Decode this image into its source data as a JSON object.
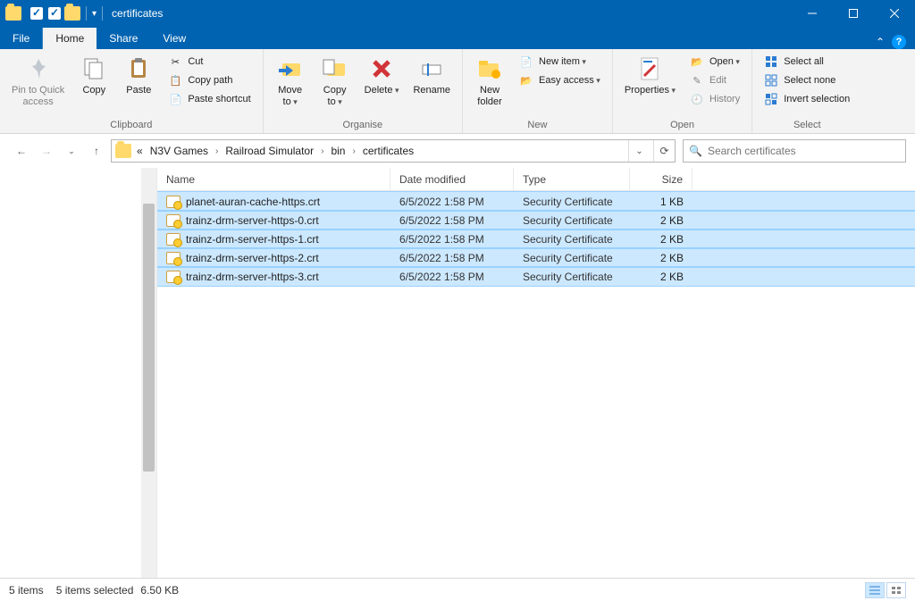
{
  "window": {
    "title": "certificates"
  },
  "tabs": {
    "file": "File",
    "home": "Home",
    "share": "Share",
    "view": "View"
  },
  "ribbon": {
    "clipboard": {
      "name": "Clipboard",
      "pin": "Pin to Quick\naccess",
      "copy": "Copy",
      "paste": "Paste",
      "cut": "Cut",
      "copypath": "Copy path",
      "pasteshortcut": "Paste shortcut"
    },
    "organise": {
      "name": "Organise",
      "move": "Move\nto",
      "copyto": "Copy\nto",
      "delete": "Delete",
      "rename": "Rename"
    },
    "new": {
      "name": "New",
      "newfolder": "New\nfolder",
      "newitem": "New item",
      "easyaccess": "Easy access"
    },
    "open": {
      "name": "Open",
      "properties": "Properties",
      "open": "Open",
      "edit": "Edit",
      "history": "History"
    },
    "select": {
      "name": "Select",
      "selectall": "Select all",
      "selectnone": "Select none",
      "invert": "Invert selection"
    }
  },
  "breadcrumbs": [
    "«",
    "N3V Games",
    "Railroad Simulator",
    "bin",
    "certificates"
  ],
  "search_placeholder": "Search certificates",
  "columns": {
    "name": "Name",
    "date": "Date modified",
    "type": "Type",
    "size": "Size"
  },
  "files": [
    {
      "name": "planet-auran-cache-https.crt",
      "date": "6/5/2022 1:58 PM",
      "type": "Security Certificate",
      "size": "1 KB"
    },
    {
      "name": "trainz-drm-server-https-0.crt",
      "date": "6/5/2022 1:58 PM",
      "type": "Security Certificate",
      "size": "2 KB"
    },
    {
      "name": "trainz-drm-server-https-1.crt",
      "date": "6/5/2022 1:58 PM",
      "type": "Security Certificate",
      "size": "2 KB"
    },
    {
      "name": "trainz-drm-server-https-2.crt",
      "date": "6/5/2022 1:58 PM",
      "type": "Security Certificate",
      "size": "2 KB"
    },
    {
      "name": "trainz-drm-server-https-3.crt",
      "date": "6/5/2022 1:58 PM",
      "type": "Security Certificate",
      "size": "2 KB"
    }
  ],
  "status": {
    "items": "5 items",
    "selected": "5 items selected",
    "size": "6.50 KB"
  }
}
